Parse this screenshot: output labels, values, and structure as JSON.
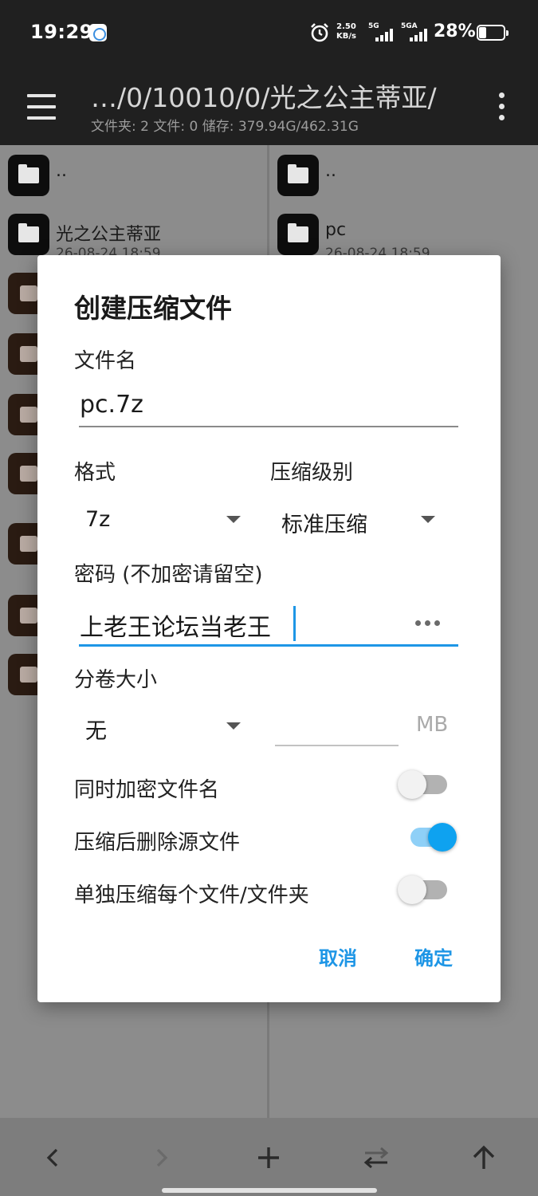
{
  "status_bar": {
    "time": "19:29",
    "net_speed_value": "2.50",
    "net_speed_unit": "KB/s",
    "sim1_type": "5G",
    "sim2_type": "5GA",
    "battery": "28%"
  },
  "toolbar": {
    "path": "…/0/10010/0/光之公主蒂亚/",
    "summary": "文件夹: 2  文件: 0  储存: 379.94G/462.31G"
  },
  "left_pane": {
    "items": [
      {
        "name": "..",
        "date": ""
      },
      {
        "name": "光之公主蒂亚",
        "date": "26-08-24 18:59"
      }
    ]
  },
  "right_pane": {
    "items": [
      {
        "name": "..",
        "date": ""
      },
      {
        "name": "pc",
        "date": "26-08-24 18:59"
      }
    ]
  },
  "dialog": {
    "title": "创建压缩文件",
    "filename_label": "文件名",
    "filename_value": "pc.7z",
    "format_label": "格式",
    "format_value": "7z",
    "level_label": "压缩级别",
    "level_value": "标准压缩",
    "password_label": "密码 (不加密请留空)",
    "password_value": "上老王论坛当老王",
    "split_label": "分卷大小",
    "split_value": "无",
    "split_size_value": "",
    "split_unit": "MB",
    "opt_encrypt_names": {
      "label": "同时加密文件名",
      "on": false
    },
    "opt_delete_source": {
      "label": "压缩后删除源文件",
      "on": true
    },
    "opt_separate": {
      "label": "单独压缩每个文件/文件夹",
      "on": false
    },
    "cancel_label": "取消",
    "ok_label": "确定"
  },
  "colors": {
    "accent": "#1e96e6",
    "toggle_on": "#0ea2f0",
    "bar_bg": "#202020"
  },
  "icons": {
    "menu": "hamburger-menu-icon",
    "more": "more-vertical-icon",
    "folder": "folder-icon",
    "archive": "archive-icon",
    "back": "chevron-left-icon",
    "forward": "chevron-right-icon",
    "add": "plus-icon",
    "swap": "swap-icon",
    "up": "arrow-up-icon"
  }
}
